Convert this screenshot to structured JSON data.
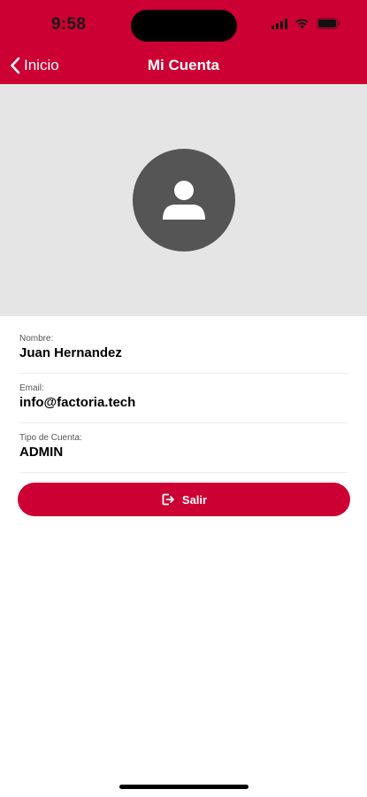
{
  "status_bar": {
    "time": "9:58"
  },
  "nav": {
    "back_label": "Inicio",
    "title": "Mi Cuenta"
  },
  "profile": {
    "avatar_icon": "person-icon",
    "fields": [
      {
        "label": "Nombre:",
        "value": "Juan Hernandez"
      },
      {
        "label": "Email:",
        "value": "info@factoria.tech"
      },
      {
        "label": "Tipo de Cuenta:",
        "value": "ADMIN"
      }
    ]
  },
  "logout": {
    "label": "Salir",
    "icon": "logout-icon"
  },
  "colors": {
    "brand": "#cc0033",
    "avatar_bg": "#555555",
    "header_area_bg": "#e5e5e5"
  }
}
